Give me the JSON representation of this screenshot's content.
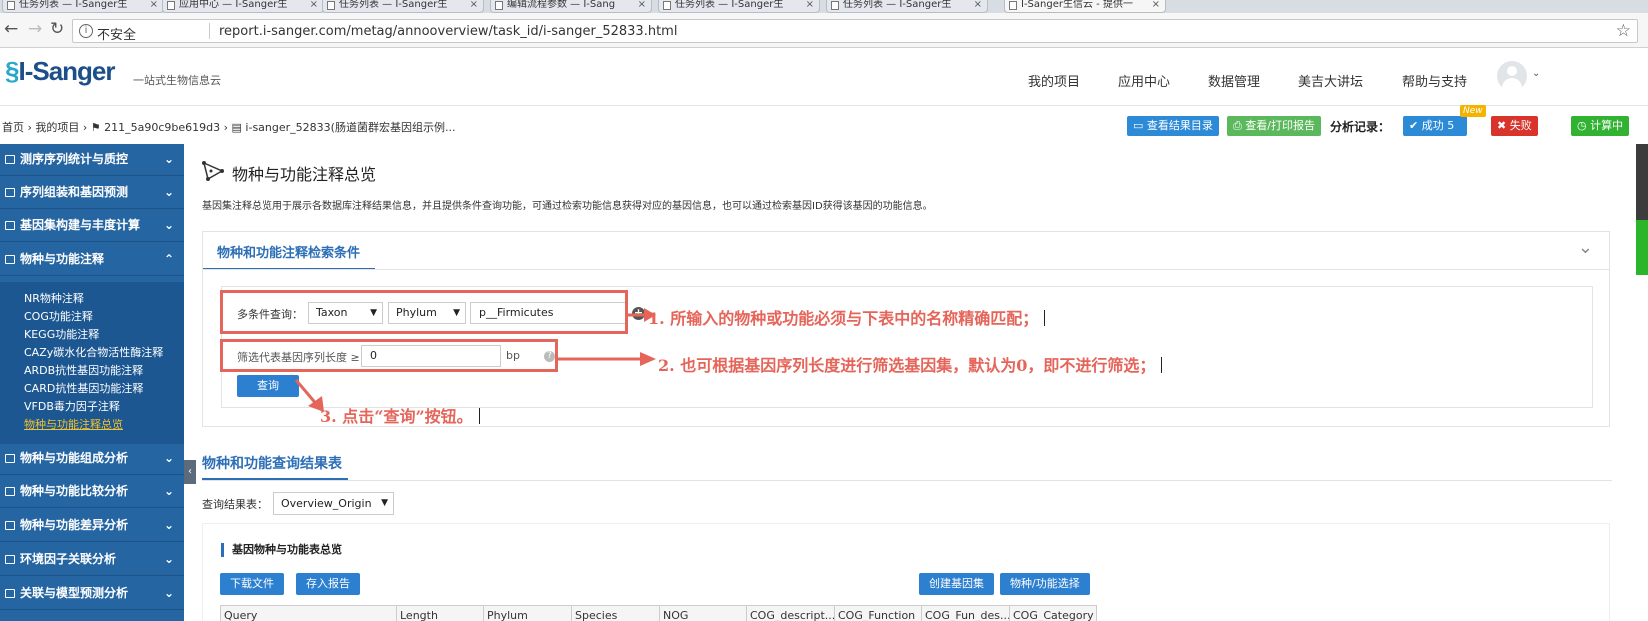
{
  "browser": {
    "tabs": [
      "任务列表 — I-Sanger生",
      "应用中心 — I-Sanger生",
      "任务列表 — I-Sanger生",
      "编辑流程参数 — I-Sang",
      "任务列表 — I-Sanger生",
      "任务列表 — I-Sanger生",
      "I-Sanger生信云 - 提供一"
    ],
    "security": "不安全",
    "url": "report.i-sanger.com/metag/annooverview/task_id/i-sanger_52833.html"
  },
  "header": {
    "logo": "I-Sanger",
    "slogan": "一站式生物信息云",
    "nav": [
      "我的项目",
      "应用中心",
      "数据管理",
      "美吉大讲坛",
      "帮助与支持"
    ]
  },
  "breadcrumb": "首页 › 我的项目 › ⚑ 211_5a90c9be619d3 › ▤ i-sanger_52833(肠道菌群宏基因组示例...",
  "actions": {
    "view_results": "查看结果目录",
    "print_report": "查看/打印报告",
    "record_label": "分析记录：",
    "success": "成功 5",
    "new_badge": "New",
    "fail": "失败",
    "computing": "计算中"
  },
  "sidebar": {
    "sections": [
      "测序序列统计与质控",
      "序列组装和基因预测",
      "基因集构建与丰度计算",
      "物种与功能注释",
      "物种与功能组成分析",
      "物种与功能比较分析",
      "物种与功能差异分析",
      "环境因子关联分析",
      "关联与模型预测分析"
    ],
    "sub_items": [
      "NR物种注释",
      "COG功能注释",
      "KEGG功能注释",
      "CAZy碳水化合物活性酶注释",
      "ARDB抗性基因功能注释",
      "CARD抗性基因功能注释",
      "VFDB毒力因子注释",
      "物种与功能注释总览"
    ]
  },
  "page": {
    "title": "物种与功能注释总览",
    "description": "基因集注释总览用于展示各数据库注释结果信息，并且提供条件查询功能，可通过检索功能信息获得对应的基因信息，也可以通过检索基因ID获得该基因的功能信息。"
  },
  "search": {
    "panel_title": "物种和功能注释检索条件",
    "multi_label": "多条件查询：",
    "select1": "Taxon",
    "select2": "Phylum",
    "value": "p__Firmicutes",
    "length_label": "筛选代表基因序列长度 ≥",
    "length_value": "0",
    "unit": "bp",
    "query_button": "查询"
  },
  "annotations": [
    "1. 所输入的物种或功能必须与下表中的名称精确匹配；",
    "2. 也可根据基因序列长度进行筛选基因集，默认为0，即不进行筛选；",
    "3. 点击“查询”按钮。"
  ],
  "results": {
    "title": "物种和功能查询结果表",
    "table_label": "查询结果表：",
    "table_select": "Overview_Origin",
    "panel_title": "基因物种与功能表总览",
    "download": "下载文件",
    "save_report": "存入报告",
    "create_geneset": "创建基因集",
    "choose": "物种/功能选择",
    "columns": [
      "Query",
      "Length",
      "Phylum",
      "Species",
      "NOG",
      "COG_descript...",
      "COG_Function",
      "COG_Fun_des...",
      "COG_Category"
    ]
  },
  "colors": {
    "sidebar": "#2565a2",
    "accent": "#2d6fb7",
    "annotation": "#e5655a"
  }
}
